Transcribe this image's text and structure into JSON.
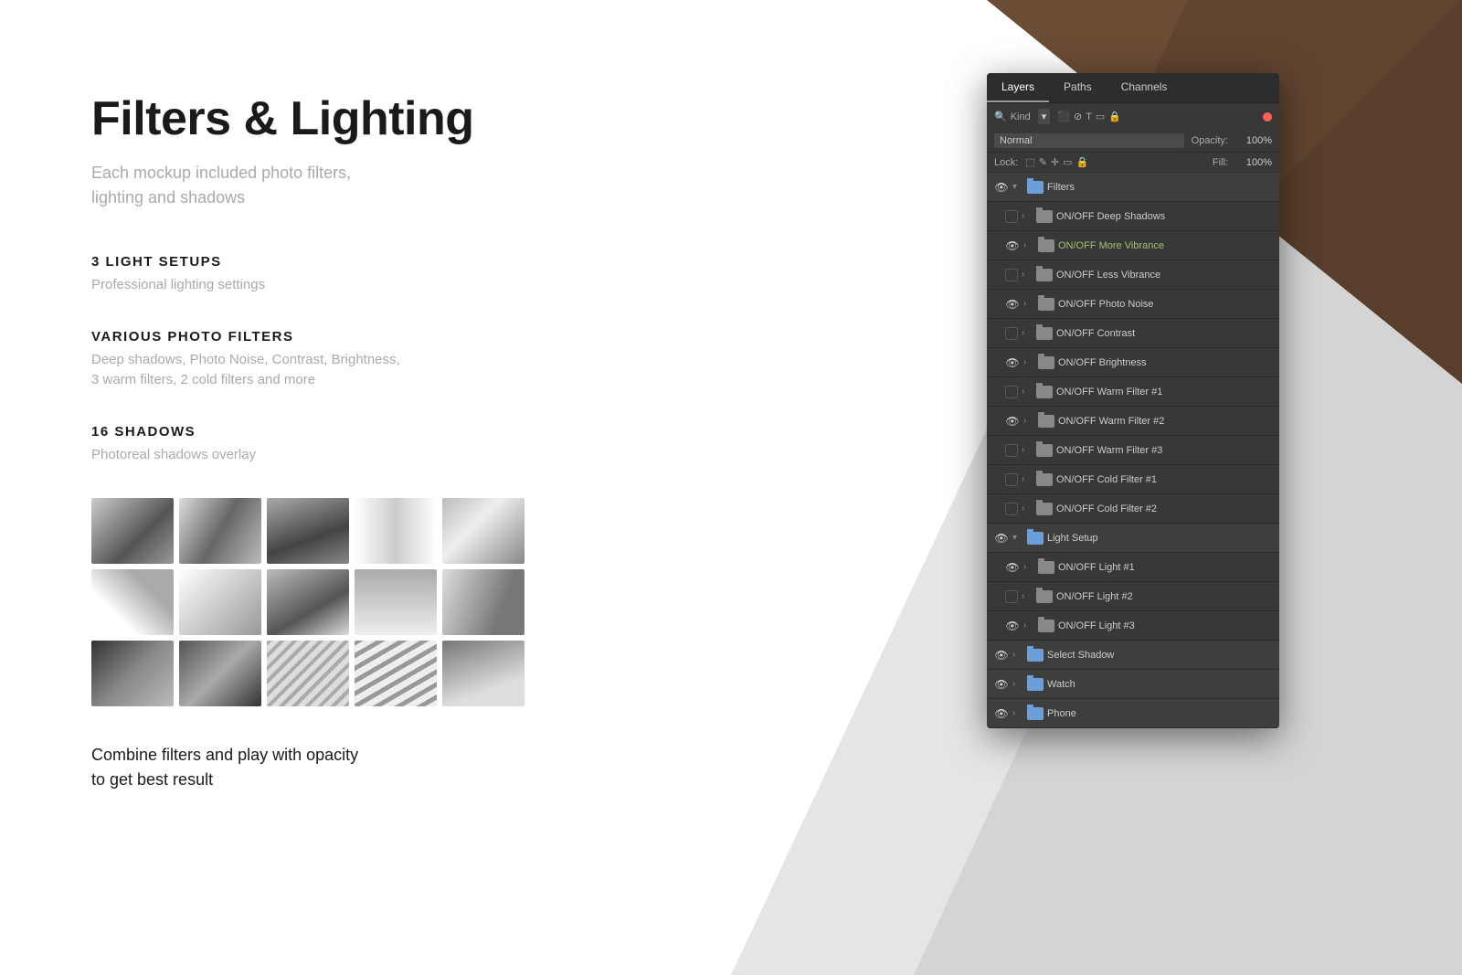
{
  "background": {
    "brown_corner_color": "#6b4c35"
  },
  "content": {
    "main_title": "Filters & Lighting",
    "main_subtitle": "Each mockup included photo filters,\nlighting and shadows",
    "sections": [
      {
        "heading": "3 LIGHT SETUPS",
        "description": "Professional lighting settings"
      },
      {
        "heading": "VARIOUS PHOTO FILTERS",
        "description": "Deep shadows, Photo Noise, Contrast, Brightness,\n3 warm filters, 2 cold filters and more"
      },
      {
        "heading": "16 SHADOWS",
        "description": "Photoreal shadows overlay"
      }
    ],
    "bottom_text": "Combine filters and play with opacity\nto get best result"
  },
  "ps_panel": {
    "tabs": [
      "Layers",
      "Paths",
      "Channels"
    ],
    "active_tab": "Layers",
    "kind_label": "Kind",
    "blend_mode": "Normal",
    "opacity_label": "Opacity:",
    "opacity_value": "100%",
    "lock_label": "Lock:",
    "fill_label": "Fill:",
    "fill_value": "100%",
    "layers": [
      {
        "name": "Filters",
        "type": "group",
        "visible": true,
        "expanded": true,
        "indent": 0
      },
      {
        "name": "ON/OFF Deep Shadows",
        "type": "folder",
        "visible": false,
        "indent": 1
      },
      {
        "name": "ON/OFF More Vibrance",
        "type": "folder",
        "visible": true,
        "indent": 1,
        "name_style": "vibrance"
      },
      {
        "name": "ON/OFF Less Vibrance",
        "type": "folder",
        "visible": false,
        "indent": 1
      },
      {
        "name": "ON/OFF Photo Noise",
        "type": "folder",
        "visible": true,
        "indent": 1
      },
      {
        "name": "ON/OFF Contrast",
        "type": "folder",
        "visible": false,
        "indent": 1
      },
      {
        "name": "ON/OFF Brightness",
        "type": "folder",
        "visible": true,
        "indent": 1
      },
      {
        "name": "ON/OFF Warm Filter #1",
        "type": "folder",
        "visible": false,
        "indent": 1
      },
      {
        "name": "ON/OFF Warm Filter #2",
        "type": "folder",
        "visible": true,
        "indent": 1
      },
      {
        "name": "ON/OFF Warm Filter #3",
        "type": "folder",
        "visible": false,
        "indent": 1
      },
      {
        "name": "ON/OFF Cold Filter #1",
        "type": "folder",
        "visible": false,
        "indent": 1
      },
      {
        "name": "ON/OFF Cold Filter #2",
        "type": "folder",
        "visible": false,
        "indent": 1
      },
      {
        "name": "Light Setup",
        "type": "group",
        "visible": true,
        "expanded": true,
        "indent": 0
      },
      {
        "name": "ON/OFF Light #1",
        "type": "folder",
        "visible": true,
        "indent": 1
      },
      {
        "name": "ON/OFF Light #2",
        "type": "folder",
        "visible": false,
        "indent": 1
      },
      {
        "name": "ON/OFF Light #3",
        "type": "folder",
        "visible": true,
        "indent": 1
      },
      {
        "name": "Select Shadow",
        "type": "group",
        "visible": true,
        "expanded": false,
        "indent": 0
      },
      {
        "name": "Watch",
        "type": "group",
        "visible": true,
        "expanded": false,
        "indent": 0
      },
      {
        "name": "Phone",
        "type": "group",
        "visible": true,
        "expanded": false,
        "indent": 0
      }
    ]
  }
}
